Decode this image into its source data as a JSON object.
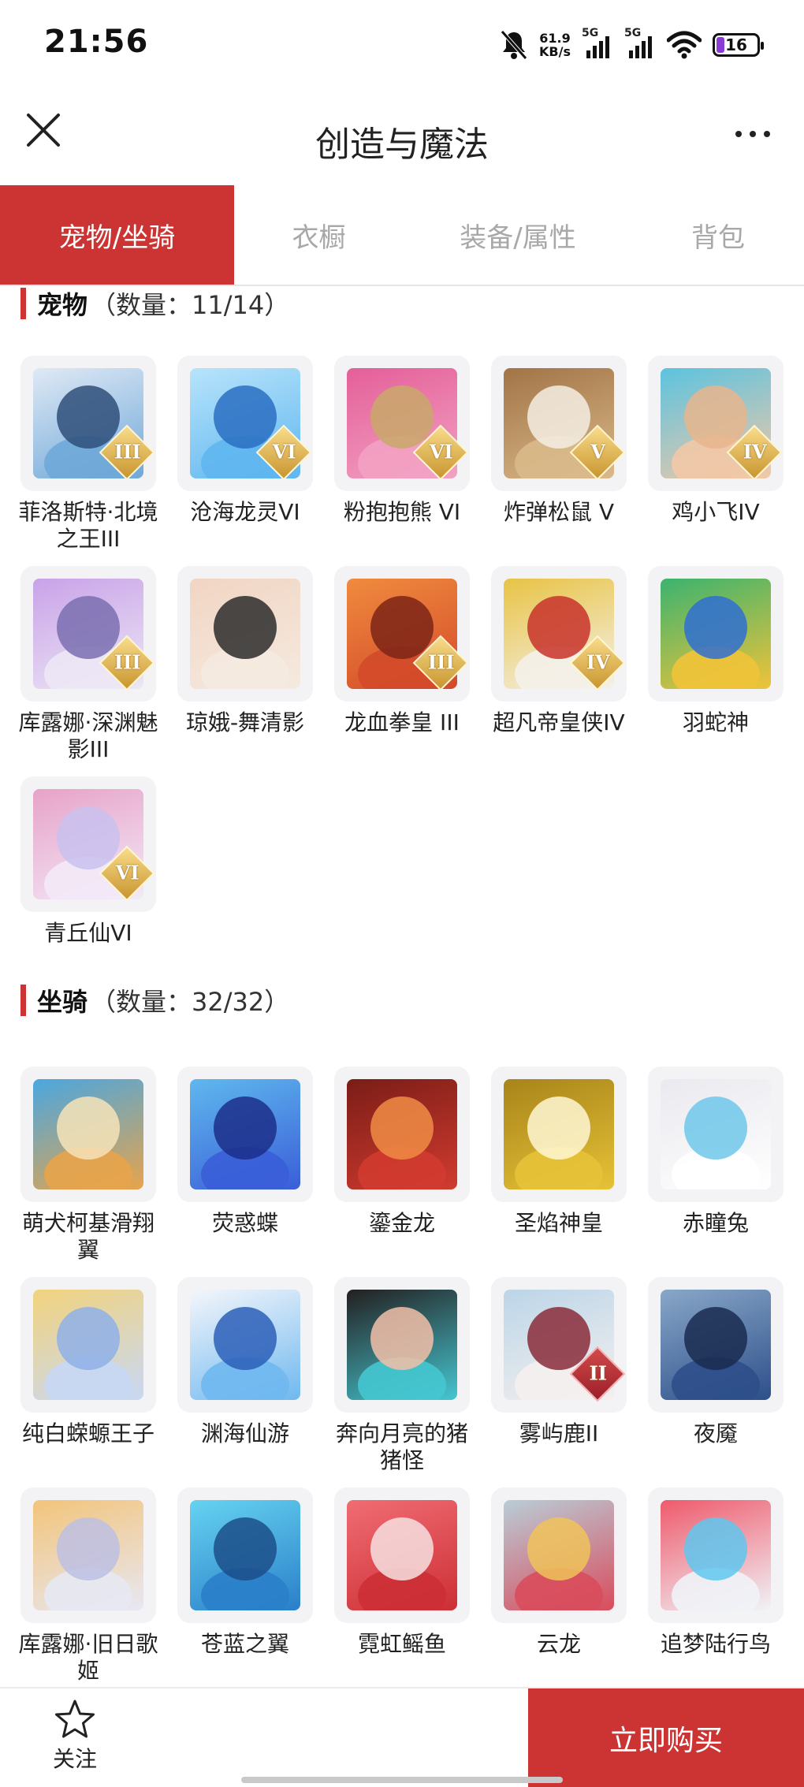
{
  "status": {
    "time": "21:56",
    "speed_value": "61.9",
    "speed_unit": "KB/s",
    "sig1_label": "5G",
    "sig2_label": "5G",
    "battery": "16"
  },
  "header": {
    "title": "创造与魔法"
  },
  "tabs": [
    {
      "label": "宠物/坐骑",
      "active": true
    },
    {
      "label": "衣橱",
      "active": false
    },
    {
      "label": "装备/属性",
      "active": false
    },
    {
      "label": "背包",
      "active": false
    }
  ],
  "pets": {
    "title": "宠物",
    "count": "（数量：11/14）",
    "items": [
      {
        "name": "菲洛斯特·北境之王III",
        "rank": "III"
      },
      {
        "name": "沧海龙灵VI",
        "rank": "VI"
      },
      {
        "name": "粉抱抱熊 VI",
        "rank": "VI"
      },
      {
        "name": "炸弹松鼠 V",
        "rank": "V"
      },
      {
        "name": "鸡小飞IV",
        "rank": "IV"
      },
      {
        "name": "库露娜·深渊魅影III",
        "rank": "III"
      },
      {
        "name": "琼娥-舞清影",
        "rank": ""
      },
      {
        "name": "龙血拳皇 III",
        "rank": "III"
      },
      {
        "name": "超凡帝皇侠IV",
        "rank": "IV"
      },
      {
        "name": "羽蛇神",
        "rank": ""
      },
      {
        "name": "青丘仙VI",
        "rank": "VI"
      }
    ]
  },
  "mounts": {
    "title": "坐骑",
    "count": "（数量：32/32）",
    "items": [
      {
        "name": "萌犬柯基滑翔翼",
        "rank": ""
      },
      {
        "name": "荧惑蝶",
        "rank": ""
      },
      {
        "name": "鎏金龙",
        "rank": ""
      },
      {
        "name": "圣焰神皇",
        "rank": ""
      },
      {
        "name": "赤瞳兔",
        "rank": ""
      },
      {
        "name": "纯白蝾螈王子",
        "rank": ""
      },
      {
        "name": "渊海仙游",
        "rank": ""
      },
      {
        "name": "奔向月亮的猪猪怪",
        "rank": ""
      },
      {
        "name": "雾屿鹿II",
        "rank": "II"
      },
      {
        "name": "夜魇",
        "rank": ""
      },
      {
        "name": "库露娜·旧日歌姬",
        "rank": ""
      },
      {
        "name": "苍蓝之翼",
        "rank": ""
      },
      {
        "name": "霓虹鳐鱼",
        "rank": ""
      },
      {
        "name": "云龙",
        "rank": ""
      },
      {
        "name": "追梦陆行鸟",
        "rank": ""
      }
    ]
  },
  "bottom": {
    "follow_label": "关注",
    "buy_label": "立即购买"
  },
  "colors": {
    "accent": "#cc3333",
    "tab_inactive": "#a8a8a8",
    "card_bg": "#f3f3f5"
  }
}
